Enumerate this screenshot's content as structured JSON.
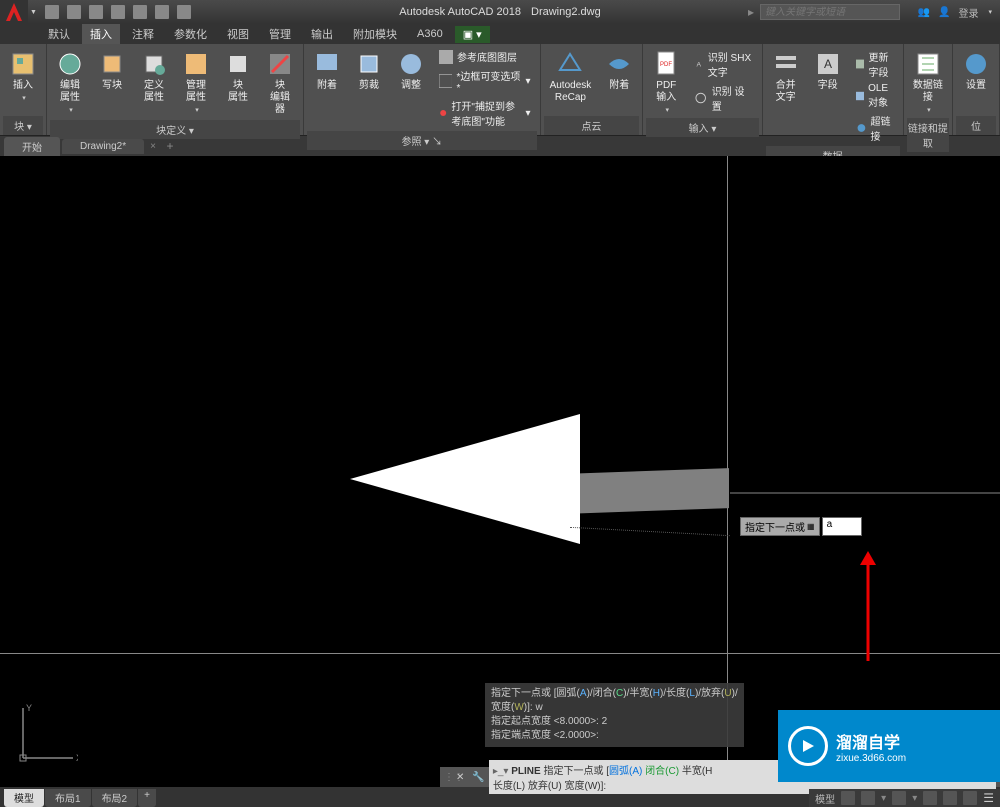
{
  "title": {
    "app": "Autodesk AutoCAD 2018",
    "doc": "Drawing2.dwg"
  },
  "search_placeholder": "键入关键字或短语",
  "login_label": "登录",
  "menubar": [
    "默认",
    "插入",
    "注释",
    "参数化",
    "视图",
    "管理",
    "输出",
    "附加模块",
    "A360"
  ],
  "menubar_active": 1,
  "ribbon": {
    "panels": [
      {
        "label": "块",
        "big": [
          {
            "name": "insert-block",
            "text": "插入"
          }
        ],
        "dropdown": true
      },
      {
        "label": "块定义",
        "big": [
          {
            "name": "edit-attr",
            "text": "编辑\n属性"
          },
          {
            "name": "write-block",
            "text": "写块"
          },
          {
            "name": "define-attr",
            "text": "定义属性"
          },
          {
            "name": "manage-attr",
            "text": "管理\n属性"
          },
          {
            "name": "block-attr",
            "text": "块\n属性"
          },
          {
            "name": "block-editor",
            "text": "块\n编辑器"
          }
        ],
        "dropdown": true
      },
      {
        "label": "参照",
        "big": [
          {
            "name": "attach",
            "text": "附着"
          },
          {
            "name": "clip",
            "text": "剪裁"
          },
          {
            "name": "adjust",
            "text": "调整"
          }
        ],
        "small": [
          {
            "icon": "layer",
            "text": "参考底图图层"
          },
          {
            "icon": "frame",
            "text": "*边框可变选项*"
          },
          {
            "icon": "snap",
            "text": "打开\"捕捉到参考底图\"功能"
          }
        ],
        "dropdown": true
      },
      {
        "label": "点云",
        "big": [
          {
            "name": "recap",
            "text": "Autodesk\nReCap"
          },
          {
            "name": "attach-pc",
            "text": "附着"
          }
        ]
      },
      {
        "label": "输入",
        "big": [
          {
            "name": "pdf-import",
            "text": "PDF\n输入"
          }
        ],
        "small": [
          {
            "icon": "shx",
            "text": "识别 SHX 文字"
          },
          {
            "icon": "rset",
            "text": "识别 设置"
          }
        ],
        "dropdown": true
      },
      {
        "label": "数据",
        "big": [
          {
            "name": "merge-text",
            "text": "合并\n文字"
          },
          {
            "name": "field",
            "text": "字段"
          }
        ],
        "small": [
          {
            "icon": "upd",
            "text": "更新字段"
          },
          {
            "icon": "ole",
            "text": "OLE 对象"
          },
          {
            "icon": "link",
            "text": "超链接"
          }
        ]
      },
      {
        "label": "链接和提取",
        "big": [
          {
            "name": "data-link",
            "text": "数据链接"
          }
        ]
      },
      {
        "label": "位",
        "big": [
          {
            "name": "settings",
            "text": "设置"
          }
        ]
      }
    ]
  },
  "model_tabs": [
    "开始",
    "Drawing2*"
  ],
  "dyn_input": {
    "label": "指定下一点或",
    "value": "a"
  },
  "cmd_history": {
    "line1": {
      "t1": "指定下一点或 [圆弧(",
      "a": "A",
      "t2": ")/闭合(",
      "c": "C",
      "t3": ")/半宽(",
      "h": "H",
      "t4": ")/长度(",
      "l": "L",
      "t5": ")/放弃(",
      "u": "U",
      "t6": ")/"
    },
    "line2": {
      "t1": "宽度(",
      "w": "W",
      "t2": ")]: w"
    },
    "line3": "指定起点宽度 <8.0000>: 2",
    "line4": "指定端点宽度 <2.0000>:"
  },
  "cmd_line": {
    "cmd": "PLINE",
    "prompt": "指定下一点或 [",
    "arc": "圆弧(A)",
    "close": "闭合(C)",
    "half": "半宽(H",
    "line2": "长度(L) 放弃(U) 宽度(W)]:"
  },
  "bottom_tabs": [
    "模型",
    "布局1",
    "布局2"
  ],
  "status_model": "模型",
  "watermark": {
    "main": "溜溜自学",
    "sub": "zixue.3d66.com"
  }
}
